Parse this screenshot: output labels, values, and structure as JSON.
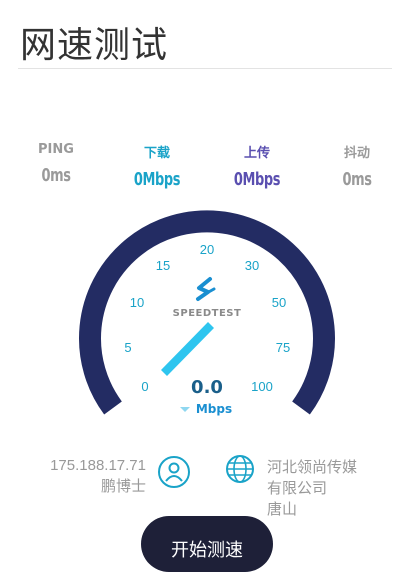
{
  "header": {
    "title": "网速测试"
  },
  "metrics": {
    "ping": {
      "label": "PING",
      "value": "0ms",
      "color": "#9a9a9a"
    },
    "download": {
      "label": "下载",
      "value": "0Mbps",
      "color": "#1aa3c8"
    },
    "upload": {
      "label": "上传",
      "value": "0Mbps",
      "color": "#5a4fb0"
    },
    "jitter": {
      "label": "抖动",
      "value": "0ms",
      "color": "#9a9a9a"
    }
  },
  "gauge": {
    "scale_labels": [
      "0",
      "5",
      "10",
      "15",
      "20",
      "30",
      "50",
      "75",
      "100"
    ],
    "brand": "SPEEDTEST",
    "current_value": "0.0",
    "unit": "Mbps",
    "arc_color": "#232c63",
    "needle_color": "#2ec5ef",
    "brand_color": "#1a8fd1"
  },
  "client": {
    "ip": "175.188.17.71",
    "isp": "鹏博士"
  },
  "server": {
    "line1": "河北领尚传媒",
    "line2": "有限公司",
    "line3": "唐山"
  },
  "actions": {
    "start_label": "开始测速"
  }
}
